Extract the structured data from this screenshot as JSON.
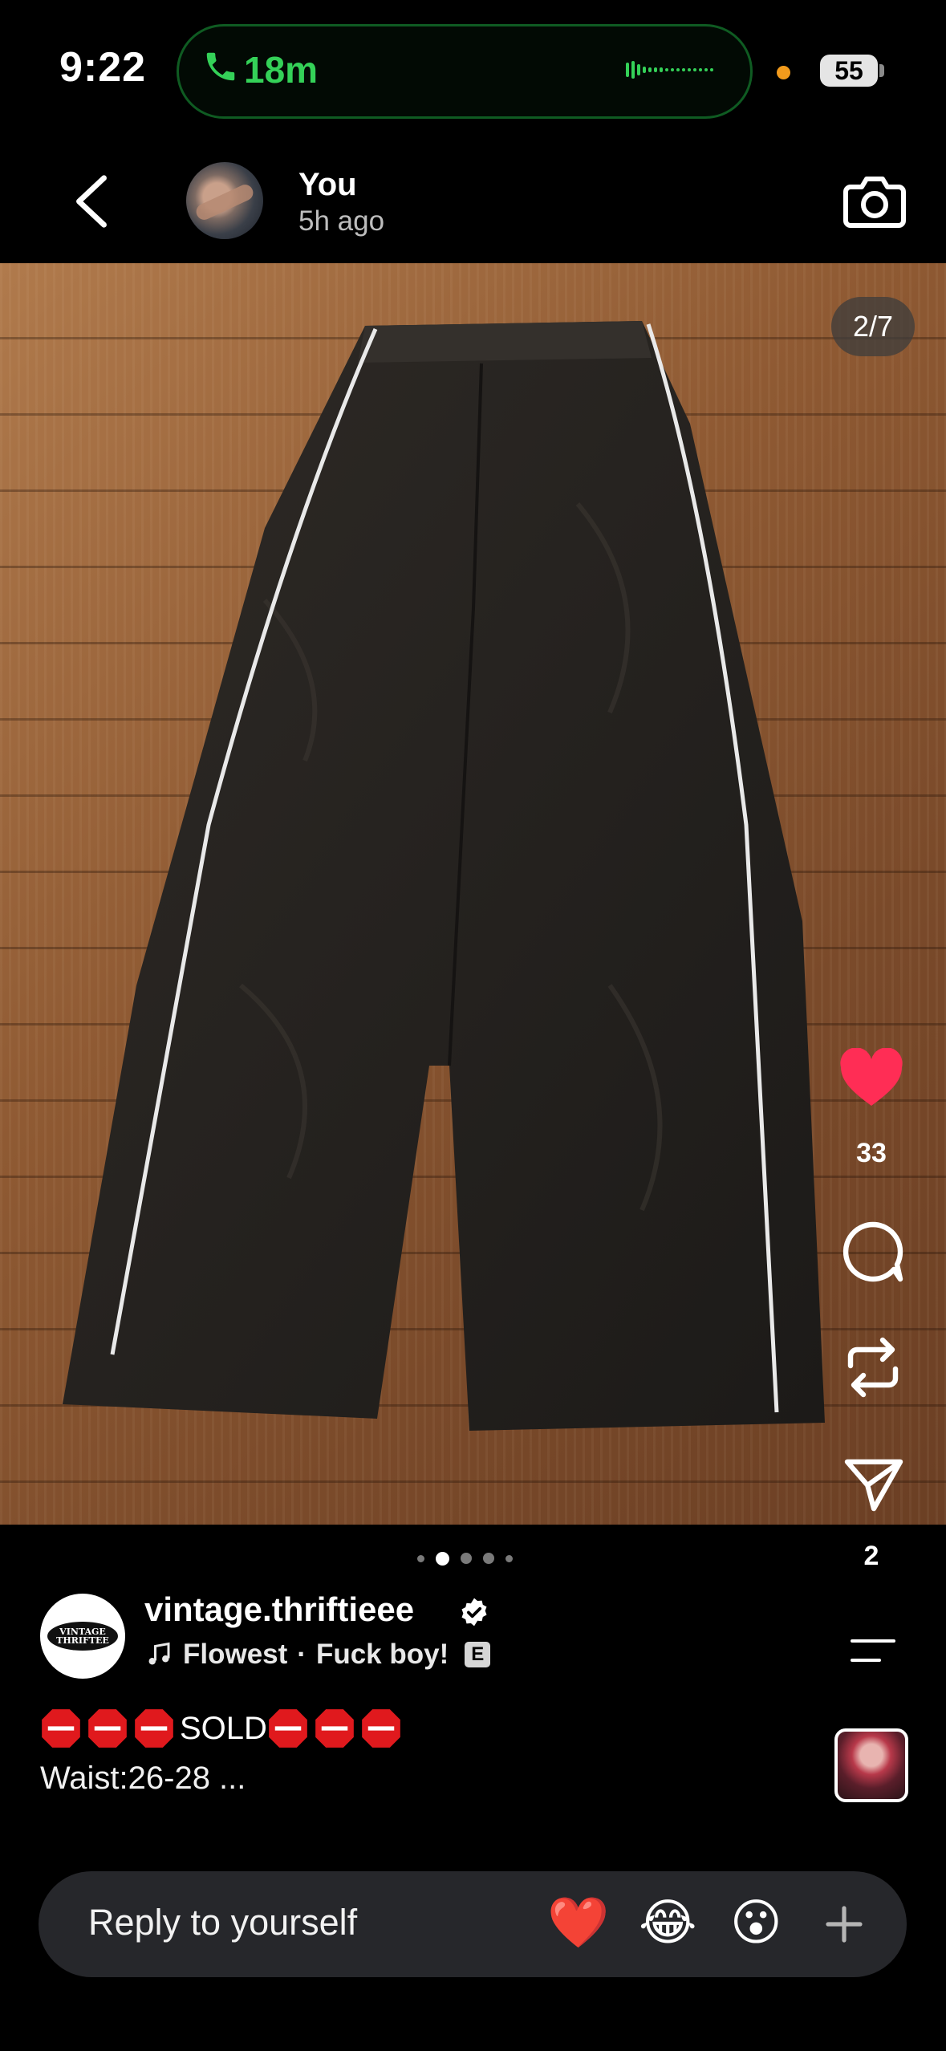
{
  "status_bar": {
    "time": "9:22",
    "call_duration": "18m",
    "battery": "55"
  },
  "header": {
    "name": "You",
    "posted": "5h ago"
  },
  "post": {
    "counter": "2/7",
    "likes": "33",
    "shares": "2",
    "carousel": {
      "total_dots": 5,
      "active_index": 1
    },
    "author": {
      "username": "vintage.thriftieee",
      "verified": true,
      "avatar_logo_text": "VINTAGE THRIFTEE"
    },
    "music": {
      "title": "Flowest",
      "separator": "·",
      "song": "Fuck boy!",
      "explicit_label": "E"
    },
    "caption": {
      "text": "SOLD",
      "line2": "Waist:26-28 ..."
    }
  },
  "reply": {
    "placeholder": "Reply to yourself",
    "quick_reactions": [
      "❤️",
      "😂",
      "😮"
    ]
  },
  "colors": {
    "accent_green": "#34d158",
    "like_red": "#ff2d55",
    "reply_bar": "#26272b"
  }
}
